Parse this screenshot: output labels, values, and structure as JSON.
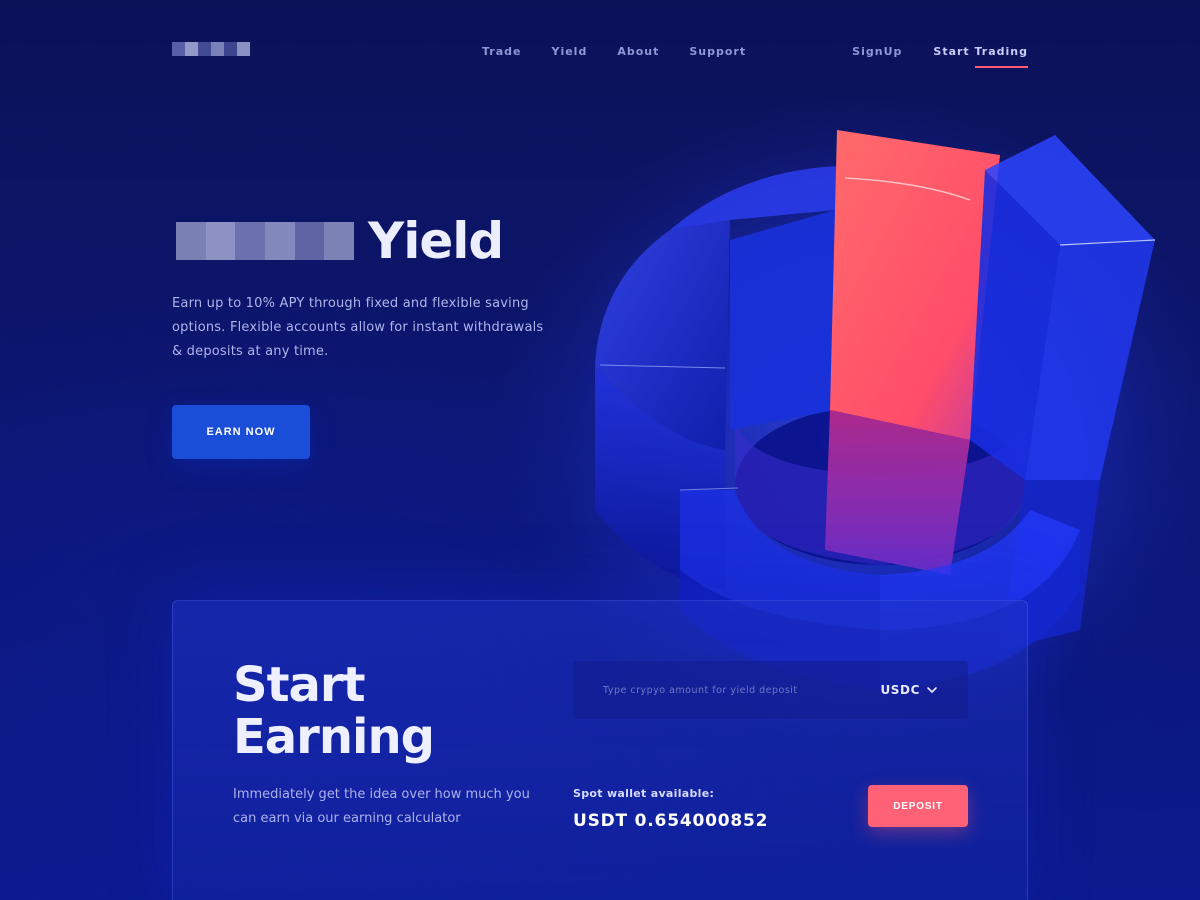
{
  "nav": {
    "links": [
      "Trade",
      "Yield",
      "About",
      "Support"
    ],
    "signup": "SignUp",
    "start_trading": "Start Trading"
  },
  "hero": {
    "title": "Yield",
    "description": "Earn up to 10% APY through fixed and flexible saving options. Flexible accounts allow for instant withdrawals & deposits at any time.",
    "cta": "EARN NOW"
  },
  "calculator": {
    "title_line1": "Start",
    "title_line2": "Earning",
    "description": "Immediately get the idea over how much you can earn via our earning calculator",
    "amount_placeholder": "Type crypyo amount for yield deposit",
    "currency": "USDC",
    "wallet_label": "Spot wallet available:",
    "wallet_value": "USDT 0.654000852",
    "deposit": "DEPOSIT"
  },
  "colors": {
    "accent": "#ff6277",
    "primary_button": "#1a4ed8",
    "background": "#0c1258"
  },
  "icons": {
    "currency_dropdown": "chevron-down-icon"
  }
}
